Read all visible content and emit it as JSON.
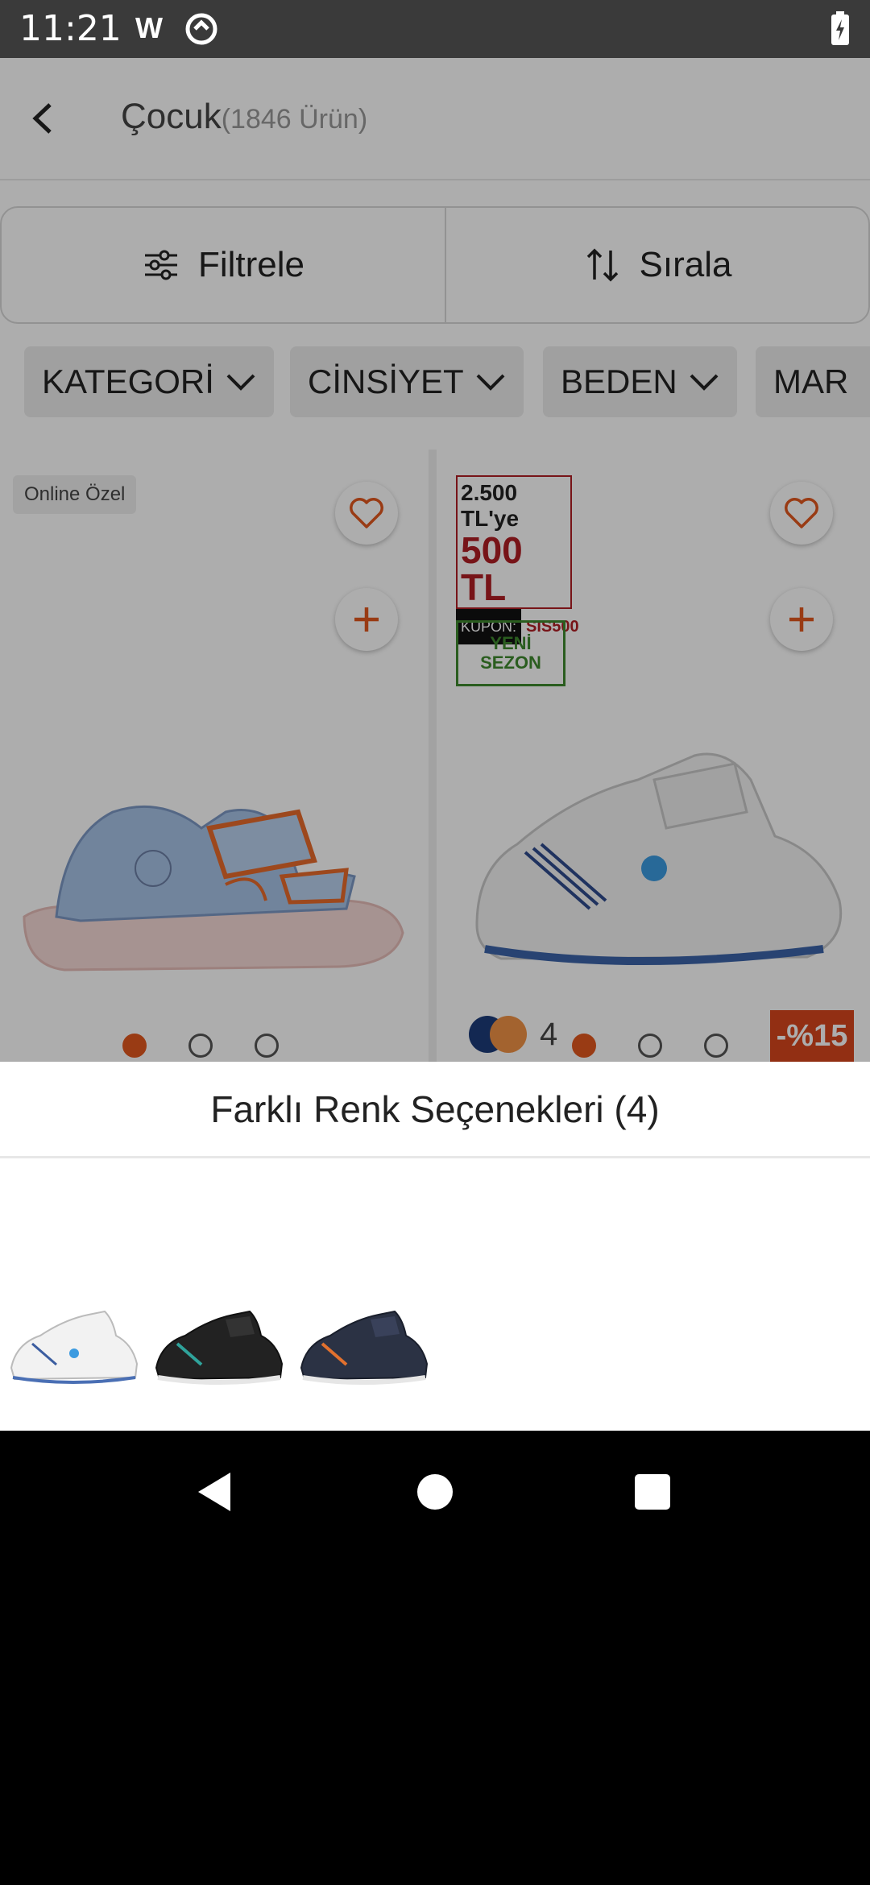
{
  "status_bar": {
    "time": "11:21",
    "w_icon": "W"
  },
  "header": {
    "title": "Çocuk",
    "count": "(1846 Ürün)"
  },
  "actions": {
    "filter_label": "Filtrele",
    "sort_label": "Sırala"
  },
  "chips": [
    "KATEGORİ",
    "CİNSİYET",
    "BEDEN",
    "MAR"
  ],
  "products": [
    {
      "badge": "Online Özel",
      "image": "kids-sandal-blue-pink",
      "dots": 3
    },
    {
      "coupon_line1": "2.500 TL'ye",
      "coupon_line2": "500 TL",
      "coupon_prefix": "KUPON:",
      "coupon_code": "SIS500",
      "new_season": [
        "YENİ",
        "SEZON"
      ],
      "swatch_count": "4",
      "discount": "-%15",
      "image": "kids-sneaker-white",
      "dots": 3
    }
  ],
  "sheet": {
    "title": "Farklı Renk Seçenekleri (4)",
    "variants": [
      "white-blue-sneaker",
      "black-teal-sneaker",
      "navy-orange-sneaker"
    ]
  },
  "colors": {
    "accent": "#e2571e",
    "coupon_red": "#b01e24",
    "new_season_green": "#3f8a2e"
  }
}
